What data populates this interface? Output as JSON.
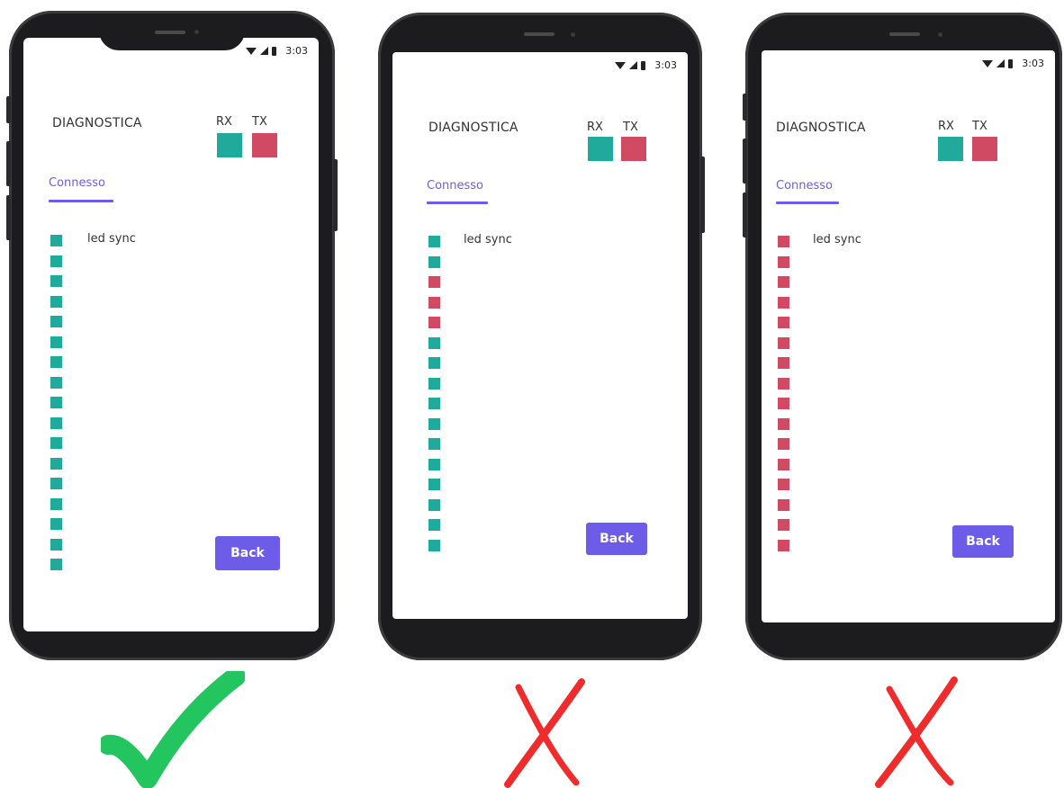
{
  "colors": {
    "on": "#1FAA9B",
    "off": "#CF4A62",
    "accent": "#6C5CE7",
    "check": "#22C55E",
    "cross": "#EF2B2B"
  },
  "phones": [
    {
      "status_time": "3:03",
      "title": "DIAGNOSTICA",
      "rx_label": "RX",
      "tx_label": "TX",
      "rx_state": "on",
      "tx_state": "off",
      "tab_label": "Connesso",
      "led_label": "led sync",
      "leds": [
        "on",
        "on",
        "on",
        "on",
        "on",
        "on",
        "on",
        "on",
        "on",
        "on",
        "on",
        "on",
        "on",
        "on",
        "on",
        "on",
        "on"
      ],
      "back_label": "Back",
      "verdict": "check-icon"
    },
    {
      "status_time": "3:03",
      "title": "DIAGNOSTICA",
      "rx_label": "RX",
      "tx_label": "TX",
      "rx_state": "on",
      "tx_state": "off",
      "tab_label": "Connesso",
      "led_label": "led sync",
      "leds": [
        "on",
        "on",
        "off",
        "off",
        "off",
        "on",
        "on",
        "on",
        "on",
        "on",
        "on",
        "on",
        "on",
        "on",
        "on",
        "on"
      ],
      "back_label": "Back",
      "verdict": "cross-icon"
    },
    {
      "status_time": "3:03",
      "title": "DIAGNOSTICA",
      "rx_label": "RX",
      "tx_label": "TX",
      "rx_state": "on",
      "tx_state": "off",
      "tab_label": "Connesso",
      "led_label": "led sync",
      "leds": [
        "off",
        "off",
        "off",
        "off",
        "off",
        "off",
        "off",
        "off",
        "off",
        "off",
        "off",
        "off",
        "off",
        "off",
        "off",
        "off"
      ],
      "back_label": "Back",
      "verdict": "cross-icon"
    }
  ]
}
